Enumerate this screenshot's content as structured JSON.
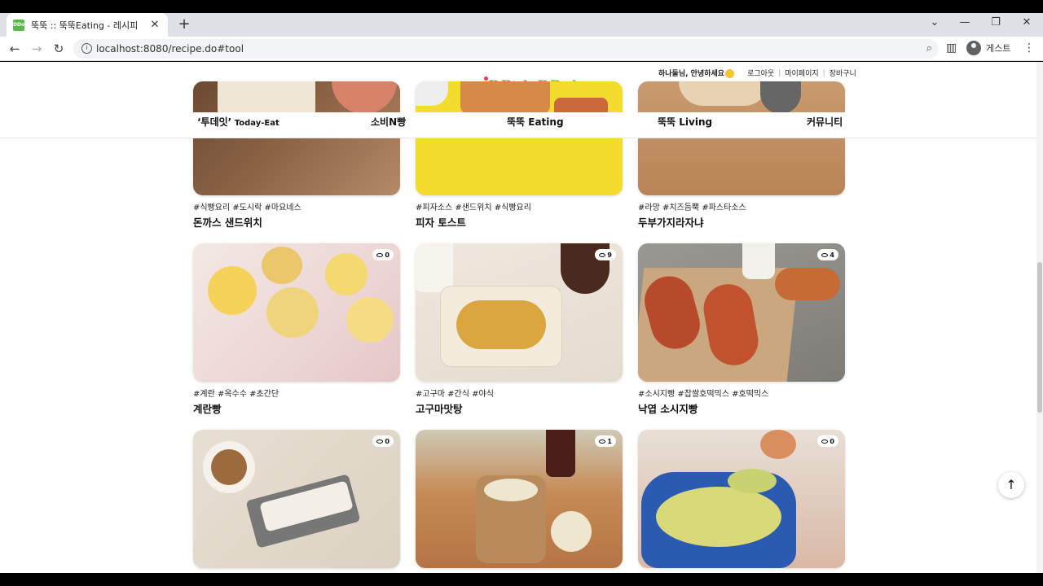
{
  "browser": {
    "tab_title": "뚝뚝 :: 뚝뚝Eating - 레시피",
    "favicon_text": "DDok",
    "url": "localhost:8080/recipe.do#tool",
    "profile_label": "게스트"
  },
  "site": {
    "logo": "DDok DDok",
    "greeting": "하나둘님, 안녕하세요",
    "logout": "로그아웃",
    "mypage": "마이페이지",
    "cart": "장바구니",
    "nav": [
      {
        "label": "‘투데잇’",
        "sub": " Today-Eat"
      },
      {
        "label": "소비N빵",
        "sub": ""
      },
      {
        "label": "뚝뚝 Eating",
        "sub": ""
      },
      {
        "label": "뚝뚝 Living",
        "sub": ""
      },
      {
        "label": "커뮤니티",
        "sub": ""
      }
    ]
  },
  "recipes": [
    {
      "tags": "#식빵요리 #도시락 #마요네스",
      "title": "돈까스 샌드위치",
      "views": ""
    },
    {
      "tags": "#피자소스 #샌드위치 #식빵요리",
      "title": "피자 토스트",
      "views": ""
    },
    {
      "tags": "#라망 #치즈듬뿍 #파스타소스",
      "title": "두부가지라자냐",
      "views": ""
    },
    {
      "tags": "#계란 #옥수수 #초간단",
      "title": "계란빵",
      "views": "0"
    },
    {
      "tags": "#고구마 #간식 #야식",
      "title": "고구마맛탕",
      "views": "9"
    },
    {
      "tags": "#소시지빵 #찹쌀호떡믹스 #호떡믹스",
      "title": "낙엽 소시지빵",
      "views": "4"
    },
    {
      "tags": "",
      "title": "",
      "views": "0"
    },
    {
      "tags": "",
      "title": "",
      "views": "1"
    },
    {
      "tags": "",
      "title": "",
      "views": "0"
    }
  ],
  "colors": {
    "brand_green": "#4caf50",
    "logo_dot": "#e53950"
  }
}
